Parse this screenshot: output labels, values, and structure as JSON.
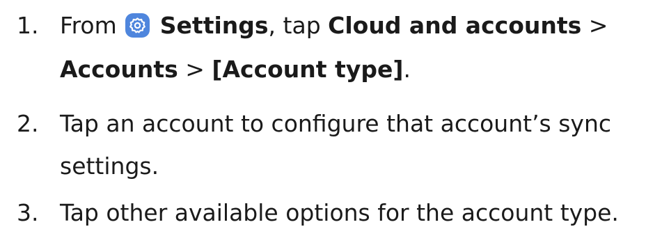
{
  "steps": [
    {
      "number": "1.",
      "line1": {
        "pre": "From",
        "icon": "settings-gear-icon",
        "settings": "Settings",
        "mid": ", tap ",
        "cloud": "Cloud and accounts",
        "sep": " >"
      },
      "line2": {
        "accounts": "Accounts",
        "sep": " > ",
        "type": "[Account type]",
        "end": "."
      }
    },
    {
      "number": "2.",
      "line1": "Tap an account to configure that account’s sync",
      "line2": "settings."
    },
    {
      "number": "3.",
      "line1": "Tap other available options for the account type."
    }
  ],
  "colors": {
    "icon_background": "#4f86dd",
    "text": "#1a1a1a"
  }
}
